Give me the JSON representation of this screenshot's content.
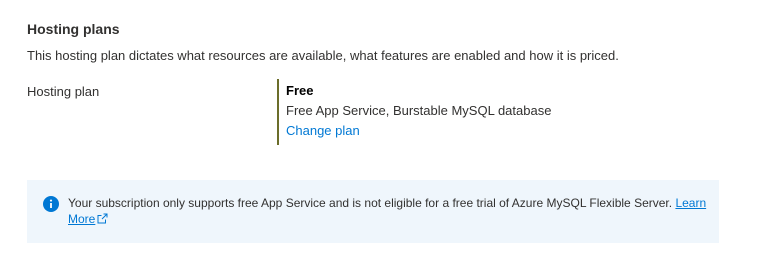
{
  "section": {
    "title": "Hosting plans",
    "description": "This hosting plan dictates what resources are available, what features are enabled and how it is priced."
  },
  "hosting_plan": {
    "label": "Hosting plan",
    "name": "Free",
    "detail": "Free App Service, Burstable MySQL database",
    "change_link": "Change plan",
    "accent_color": "#6b6d2a"
  },
  "info_banner": {
    "icon": "info-icon",
    "message": "Your subscription only supports free App Service and is not eligible for a free trial of Azure MySQL Flexible Server.",
    "link_text": "Learn More",
    "link_icon": "external-link-icon",
    "background_color": "#eff6fc",
    "icon_color": "#0078d4"
  }
}
